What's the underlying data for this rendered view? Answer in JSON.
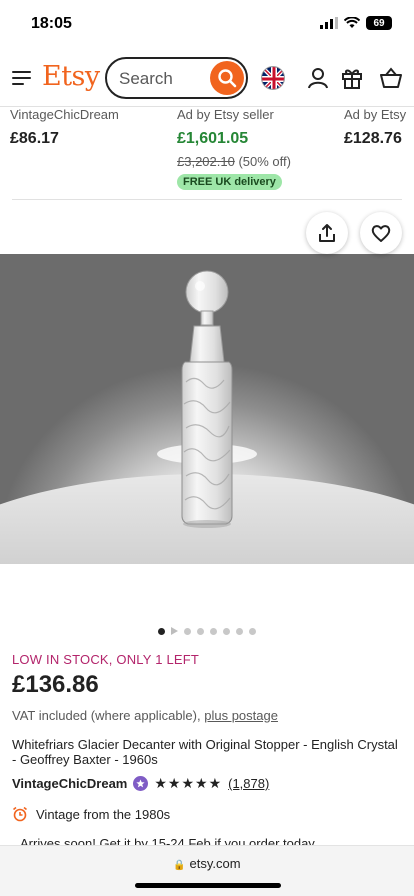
{
  "status": {
    "time": "18:05",
    "battery": "69"
  },
  "header": {
    "logo": "Etsy",
    "search_placeholder": "Search"
  },
  "listings": [
    {
      "seller": "VintageChicDream",
      "price": "£86.17"
    },
    {
      "seller": "Ad by Etsy seller",
      "price": "£1,601.05",
      "original": "£3,202.10",
      "discount": "(50% off)",
      "badge": "FREE UK delivery"
    },
    {
      "seller": "Ad by Etsy",
      "price": "£128.76"
    }
  ],
  "gallery": {
    "dot_count": 8,
    "active_index": 0
  },
  "product": {
    "stock": "LOW IN STOCK, ONLY 1 LEFT",
    "price": "£136.86",
    "vat_text": "VAT included (where applicable),",
    "postage_link": "plus postage",
    "title": "Whitefriars Glacier Decanter with Original Stopper - English Crystal - Geoffrey Baxter - 1960s",
    "shop_name": "VintageChicDream",
    "stars": "★★★★★",
    "reviews": "(1,878)",
    "vintage": "Vintage from the 1980s",
    "arrives": "Arrives soon! Get it by 15-24 Feb if you order today"
  },
  "browser": {
    "url": "etsy.com"
  },
  "colors": {
    "brand": "#f1641e",
    "stock": "#b3246b",
    "sale": "#258635",
    "badge_bg": "#9ee6a8"
  }
}
